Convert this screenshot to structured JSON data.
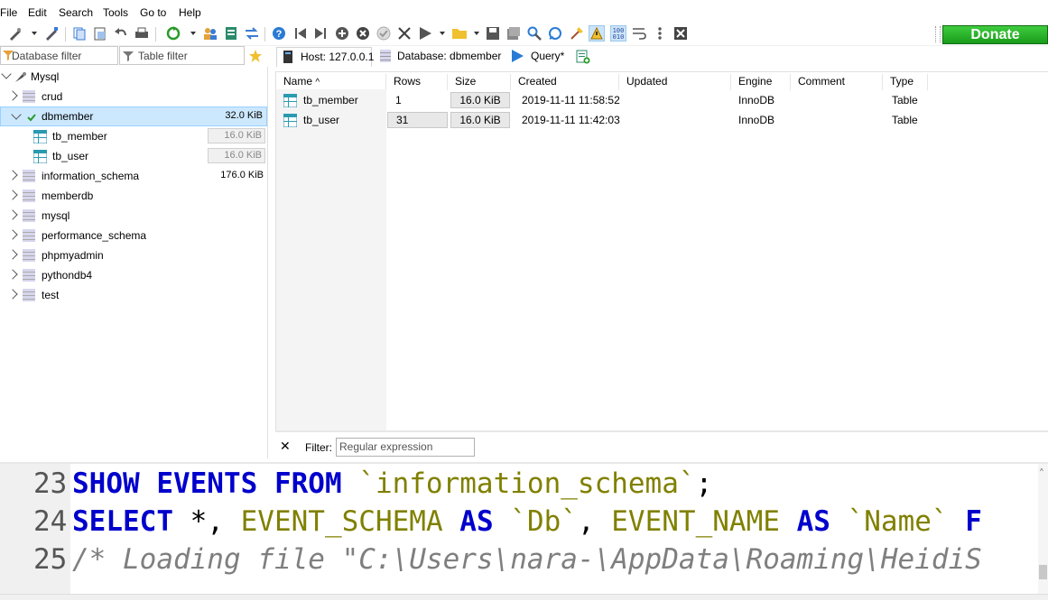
{
  "menu": [
    "File",
    "Edit",
    "Search",
    "Tools",
    "Go to",
    "Help"
  ],
  "donate_label": "Donate",
  "filters": {
    "database_placeholder": "Database filter",
    "table_placeholder": "Table filter"
  },
  "tabs": [
    {
      "label": "Host: 127.0.0.1",
      "icon": "host-icon"
    },
    {
      "label": "Database: dbmember",
      "icon": "database-icon"
    },
    {
      "label": "Query*",
      "icon": "play-icon"
    }
  ],
  "tree": {
    "root": "Mysql",
    "databases": [
      {
        "name": "crud",
        "size": "",
        "expanded": false
      },
      {
        "name": "dbmember",
        "size": "32.0 KiB",
        "expanded": true,
        "selected": true,
        "tables": [
          {
            "name": "tb_member",
            "size": "16.0 KiB"
          },
          {
            "name": "tb_user",
            "size": "16.0 KiB"
          }
        ]
      },
      {
        "name": "information_schema",
        "size": "176.0 KiB",
        "expanded": false
      },
      {
        "name": "memberdb",
        "size": "",
        "expanded": false
      },
      {
        "name": "mysql",
        "size": "",
        "expanded": false
      },
      {
        "name": "performance_schema",
        "size": "",
        "expanded": false
      },
      {
        "name": "phpmyadmin",
        "size": "",
        "expanded": false
      },
      {
        "name": "pythondb4",
        "size": "",
        "expanded": false
      },
      {
        "name": "test",
        "size": "",
        "expanded": false
      }
    ]
  },
  "grid": {
    "columns": [
      "Name",
      "Rows",
      "Size",
      "Created",
      "Updated",
      "Engine",
      "Comment",
      "Type"
    ],
    "sort_indicator": "^",
    "rows": [
      {
        "name": "tb_member",
        "rows": "1",
        "size": "16.0 KiB",
        "created": "2019-11-11 11:58:52",
        "updated": "",
        "engine": "InnoDB",
        "comment": "",
        "type": "Table"
      },
      {
        "name": "tb_user",
        "rows": "31",
        "size": "16.0 KiB",
        "created": "2019-11-11 11:42:03",
        "updated": "",
        "engine": "InnoDB",
        "comment": "",
        "type": "Table"
      }
    ]
  },
  "filterbar": {
    "label": "Filter:",
    "placeholder": "Regular expression"
  },
  "log": {
    "lines": [
      {
        "num": "23",
        "parts": [
          {
            "t": "SHOW EVENTS FROM ",
            "c": "kw"
          },
          {
            "t": "`information_schema`",
            "c": "str"
          },
          {
            "t": ";",
            "c": ""
          }
        ]
      },
      {
        "num": "24",
        "parts": [
          {
            "t": "SELECT",
            "c": "kw"
          },
          {
            "t": " *, ",
            "c": ""
          },
          {
            "t": "EVENT_SCHEMA",
            "c": "str"
          },
          {
            "t": " ",
            "c": ""
          },
          {
            "t": "AS",
            "c": "kw"
          },
          {
            "t": " ",
            "c": ""
          },
          {
            "t": "`Db`",
            "c": "str"
          },
          {
            "t": ", ",
            "c": ""
          },
          {
            "t": "EVENT_NAME",
            "c": "str"
          },
          {
            "t": " ",
            "c": ""
          },
          {
            "t": "AS",
            "c": "kw"
          },
          {
            "t": " ",
            "c": ""
          },
          {
            "t": "`Name`",
            "c": "str"
          },
          {
            "t": " F",
            "c": "kw"
          }
        ]
      },
      {
        "num": "25",
        "parts": [
          {
            "t": "/* Loading file \"C:\\Users\\nara-\\AppData\\Roaming\\HeidiS",
            "c": "cm"
          }
        ]
      }
    ]
  },
  "colors": {
    "selection": "#cce8ff",
    "keyword": "#0000cc",
    "string": "#808000",
    "comment": "#7f7f7f",
    "donate": "#22aa22"
  }
}
